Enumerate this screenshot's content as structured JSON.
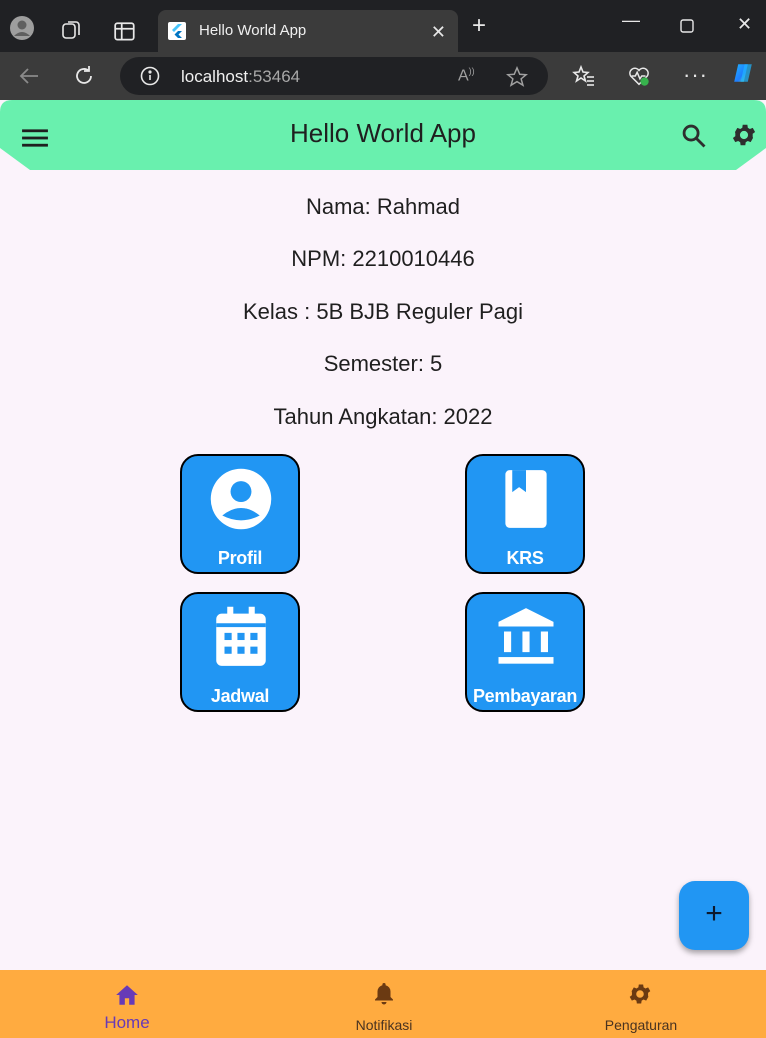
{
  "browser": {
    "tab_title": "Hello World App",
    "url_host": "localhost",
    "url_port": ":53464"
  },
  "appbar": {
    "title": "Hello World App",
    "color": "#69f0ae"
  },
  "info": {
    "nama": "Nama: Rahmad",
    "npm": "NPM: 2210010446",
    "kelas": "Kelas : 5B BJB Reguler Pagi",
    "semester": "Semester: 5",
    "tahun": "Tahun Angkatan: 2022"
  },
  "menu": [
    {
      "label": "Profil",
      "icon": "account-circle-icon"
    },
    {
      "label": "KRS",
      "icon": "book-icon"
    },
    {
      "label": "Jadwal",
      "icon": "calendar-icon"
    },
    {
      "label": "Pembayaran",
      "icon": "bank-icon"
    }
  ],
  "fab": {
    "label": "+",
    "icon": "add-icon"
  },
  "bottom_nav": {
    "items": [
      {
        "label": "Home",
        "icon": "home-icon",
        "selected": true
      },
      {
        "label": "Notifikasi",
        "icon": "bell-icon",
        "selected": false
      },
      {
        "label": "Pengaturan",
        "icon": "settings-icon",
        "selected": false
      }
    ],
    "background": "#ffab40",
    "selected_color": "#673ab7"
  }
}
